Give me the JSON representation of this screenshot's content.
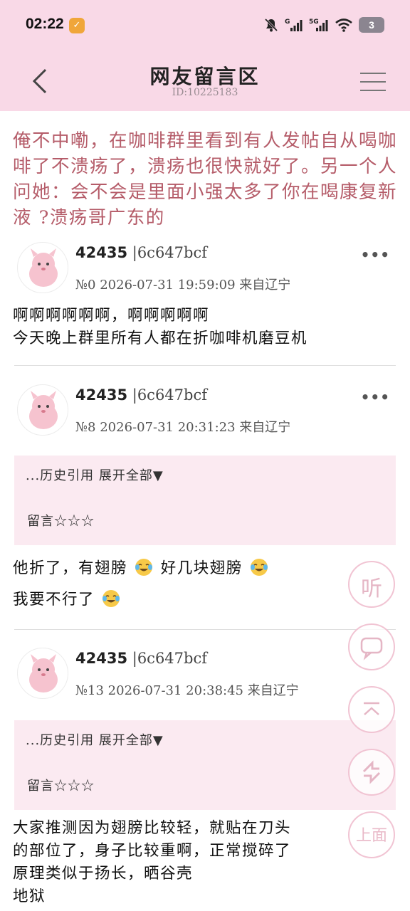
{
  "status": {
    "time": "02:22",
    "network": "5G",
    "signal": "G",
    "battery": "3"
  },
  "nav": {
    "title": "网友留言区",
    "subtitle": "ID:10225183"
  },
  "headline": "俺不中嘞，在咖啡群里看到有人发帖自从喝咖啡了不溃疡了，溃疡也很快就好了。另一个人问她：会不会是里面小强太多了你在喝康复新液 ?溃疡哥广东的",
  "posts": [
    {
      "uid": "42435",
      "hash": "|6c647bcf",
      "meta": "№0 2026-07-31 19:59:09 来自辽宁",
      "more": "•••",
      "lines": [
        "啊啊啊啊啊啊，啊啊啊啊啊",
        "今天晚上群里所有人都在折咖啡机磨豆机"
      ]
    },
    {
      "uid": "42435",
      "hash": "|6c647bcf",
      "meta": "№8 2026-07-31 20:31:23 来自辽宁",
      "more": "•••",
      "quote_expand": "...历史引用 展开全部▼",
      "quote_comment": "留言☆☆☆",
      "line1a": "他折了，有翅膀",
      "line1b": "好几块翅膀",
      "line2": "我要不行了"
    },
    {
      "uid": "42435",
      "hash": "|6c647bcf",
      "meta": "№13 2026-07-31 20:38:45 来自辽宁",
      "quote_expand": "...历史引用 展开全部▼",
      "quote_comment": "留言☆☆☆",
      "lines": [
        "大家推测因为翅膀比较轻，就贴在刀头",
        "的部位了，身子比较重啊，正常搅碎了",
        "原理类似于扬长，晒谷壳",
        "地狱"
      ]
    }
  ],
  "fabs": {
    "listen": "听",
    "top": "上面"
  },
  "colors": {
    "header_bg": "#f9d9e7",
    "headline": "#b55c69",
    "quote_bg": "#fbeaf1",
    "fab_border": "#f1c4d3"
  },
  "icons": [
    "back-arrow-icon",
    "menu-icon",
    "more-icon",
    "avatar",
    "laugh-cry-emoji",
    "comment-icon",
    "scroll-top-icon",
    "refresh-icon"
  ]
}
